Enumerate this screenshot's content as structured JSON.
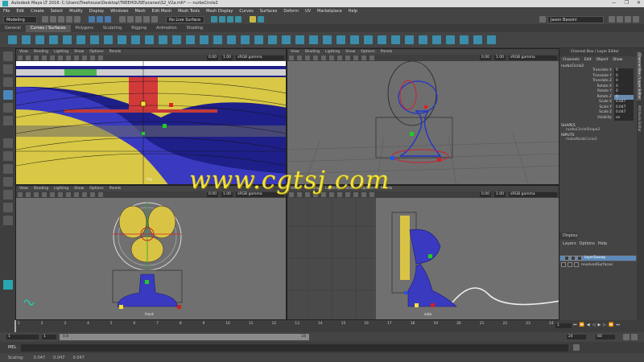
{
  "window": {
    "title": "Autodesk Maya LT 2016: C:\\Users\\Treehouse\\Desktop\\TREEHOUSE\\scenes\\S2_V2a.mlt*   ---   nurbsCircle2",
    "controls": [
      "—",
      "❐",
      "✕"
    ]
  },
  "menubar": [
    "File",
    "Edit",
    "Create",
    "Select",
    "Modify",
    "Display",
    "Windows",
    "Mesh",
    "Edit Mesh",
    "Mesh Tools",
    "Mesh Display",
    "Curves",
    "Surfaces",
    "Deform",
    "UV",
    "Marketplace",
    "Help"
  ],
  "statusline": {
    "mode": "Modeling",
    "live_surface": "No Live Surface",
    "user": "Jason Bassini"
  },
  "shelf": {
    "tabs": [
      "General",
      "Curves / Surfaces",
      "Polygons",
      "Sculpting",
      "Rigging",
      "Animation",
      "Shading"
    ],
    "active_tab": "Curves / Surfaces"
  },
  "viewport_menu": [
    "View",
    "Shading",
    "Lighting",
    "Show",
    "Options",
    "Panels"
  ],
  "viewports": {
    "top_left": {
      "label": "top",
      "near": "0.00",
      "far": "1.00",
      "gamma": "sRGB gamma"
    },
    "top_right": {
      "label": "",
      "near": "0.00",
      "far": "1.00",
      "gamma": "sRGB gamma"
    },
    "bottom_left": {
      "label": "front",
      "near": "0.00",
      "far": "1.00",
      "gamma": "sRGB gamma"
    },
    "bottom_right": {
      "label": "side",
      "near": "0.00",
      "far": "1.00",
      "gamma": "sRGB gamma"
    }
  },
  "channel_box": {
    "header": "Channel Box / Layer Editor",
    "menu": [
      "Channels",
      "Edit",
      "Object",
      "Show"
    ],
    "object": "nurbsCircle2",
    "attributes": [
      {
        "label": "Translate X",
        "value": "0"
      },
      {
        "label": "Translate Y",
        "value": "0"
      },
      {
        "label": "Translate Z",
        "value": "0"
      },
      {
        "label": "Rotate X",
        "value": "0"
      },
      {
        "label": "Rotate Y",
        "value": "0"
      },
      {
        "label": "Rotate Z",
        "value": "0"
      },
      {
        "label": "Scale X",
        "value": "0.047"
      },
      {
        "label": "Scale Y",
        "value": "0.047"
      },
      {
        "label": "Scale Z",
        "value": "0.047"
      },
      {
        "label": "Visibility",
        "value": "on"
      }
    ],
    "shapes_title": "SHAPES",
    "shapes": "nurbsCircleShape2",
    "inputs_title": "INPUTS",
    "inputs": "makeNurbCircle2"
  },
  "side_tabs": [
    "Channel Box / Layer Editor",
    "Attribute Editor"
  ],
  "layer_editor": {
    "title": "Display",
    "menu": [
      "Layers",
      "Options",
      "Help"
    ],
    "layers": [
      {
        "name": "layerSweep",
        "selected": true
      },
      {
        "name": "revolvedSurfaces",
        "selected": false
      }
    ]
  },
  "timeline": {
    "ticks": [
      "1",
      "2",
      "3",
      "4",
      "5",
      "6",
      "7",
      "8",
      "9",
      "10",
      "11",
      "12",
      "13",
      "14",
      "15",
      "16",
      "17",
      "18",
      "19",
      "20",
      "21",
      "22",
      "23",
      "24"
    ],
    "current_frame": "1"
  },
  "range": {
    "start": "1",
    "inner_start": "1",
    "inner_value": "0.8",
    "inner_end": "24",
    "end": "24",
    "max": "60"
  },
  "cmdline": {
    "lang": "MEL"
  },
  "helpline": {
    "label": "Scaling:",
    "values": [
      "0.047",
      "0.047",
      "0.047"
    ]
  },
  "watermark": "www.cgtsj.com",
  "colors": {
    "accent": "#3c8cab",
    "selection": "#5d8ab8",
    "watermark": "#f2e23a"
  }
}
